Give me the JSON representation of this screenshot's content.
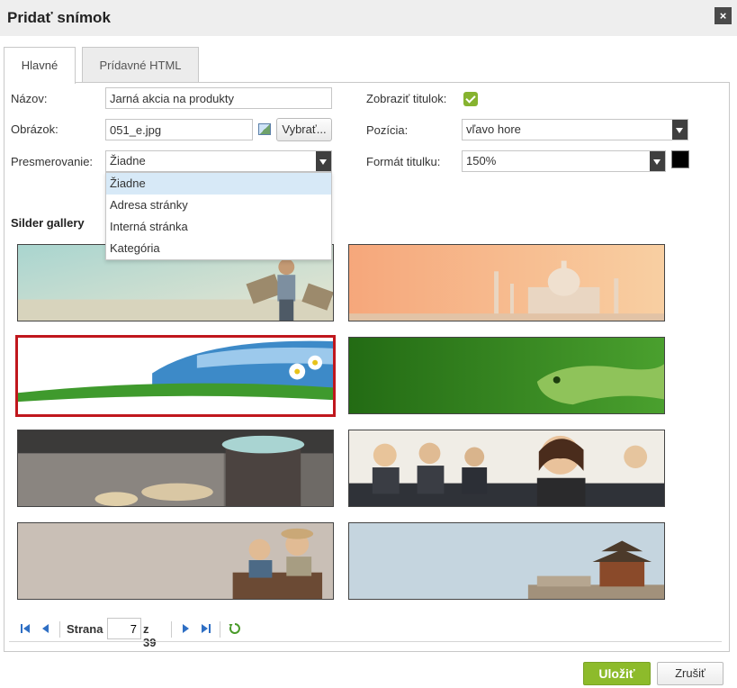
{
  "dialog": {
    "title": "Pridať snímok",
    "close": "×"
  },
  "tabs": [
    {
      "label": "Hlavné",
      "active": true
    },
    {
      "label": "Prídavné HTML",
      "active": false
    }
  ],
  "form": {
    "name_label": "Názov:",
    "name_value": "Jarná akcia na produkty",
    "image_label": "Obrázok:",
    "image_value": "051_e.jpg",
    "choose_button": "Vybrať...",
    "redirect_label": "Presmerovanie:",
    "redirect_value": "Žiadne",
    "show_title_label": "Zobraziť titulok:",
    "show_title_checked": true,
    "position_label": "Pozícia:",
    "position_value": "vľavo hore",
    "title_format_label": "Formát titulku:",
    "title_format_value": "150%",
    "title_color": "#000000"
  },
  "redirect_options": [
    "Žiadne",
    "Adresa stránky",
    "Interná stránka",
    "Kategória"
  ],
  "gallery": {
    "title": "Silder gallery",
    "items": [
      {
        "name": "boy-with-wings",
        "selected": false
      },
      {
        "name": "taj-mahal",
        "selected": false
      },
      {
        "name": "grass-daisies",
        "selected": true
      },
      {
        "name": "green-iguana",
        "selected": false
      },
      {
        "name": "coffee-macarons",
        "selected": false
      },
      {
        "name": "business-people",
        "selected": false
      },
      {
        "name": "kids-aviators",
        "selected": false
      },
      {
        "name": "chinese-pagoda",
        "selected": false
      }
    ]
  },
  "pager": {
    "page_label": "Strana",
    "current_page": "7",
    "of_label": "z 39"
  },
  "buttons": {
    "save": "Uložiť",
    "cancel": "Zrušiť"
  },
  "colors": {
    "accent": "#8dbb2b",
    "selected_border": "#c0171d",
    "pager_icon": "#2f6fc4",
    "refresh_icon": "#4a9b2a"
  }
}
